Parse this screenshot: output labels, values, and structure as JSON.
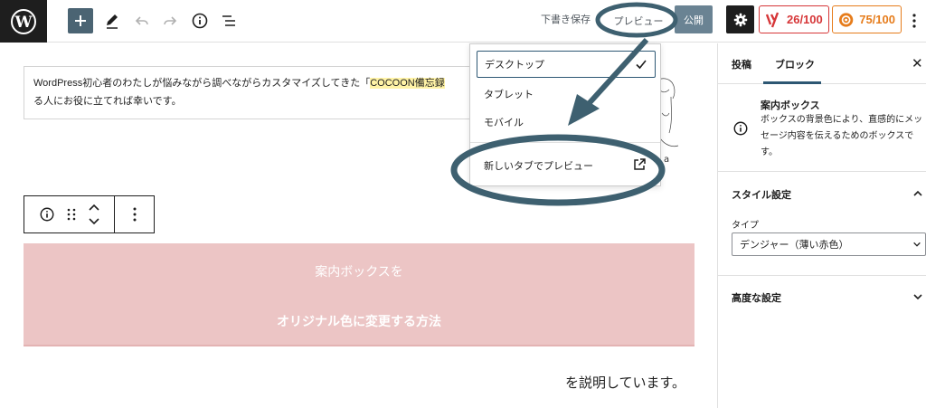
{
  "topbar": {
    "logo_icon": "wordpress-logo",
    "add_icon": "plus-icon",
    "tool_icons": [
      "pencil-icon",
      "undo-icon",
      "redo-icon",
      "info-icon",
      "list-view-icon"
    ],
    "save_draft_label": "下書き保存",
    "preview_label": "プレビュー",
    "publish_label": "公開",
    "settings_icon": "gear-icon",
    "score_red": "26/100",
    "score_orange": "75/100",
    "more_icon": "kebab-icon"
  },
  "editor": {
    "paragraph_before": "WordPress初心者のわたしが悩みながら調べながらカスタマイズしてきた「",
    "paragraph_highlight": "COCOON備忘録",
    "paragraph_line2": "る人にお役に立てれば幸いです。",
    "sketch_letter": "a",
    "notice_line1": "案内ボックスを",
    "notice_line2": "オリジナル色に変更する方法",
    "trailing_text": "を説明しています。"
  },
  "preview_menu": {
    "items": [
      {
        "label": "デスクトップ",
        "checked": true
      },
      {
        "label": "タブレット",
        "checked": false
      },
      {
        "label": "モバイル",
        "checked": false
      }
    ],
    "new_tab_label": "新しいタブでプレビュー",
    "new_tab_icon": "external-link-icon"
  },
  "sidebar": {
    "tab_post": "投稿",
    "tab_block": "ブロック",
    "block_title": "案内ボックス",
    "block_description": "ボックスの背景色により、直感的にメッセージ内容を伝えるためのボックスです。",
    "style_panel_title": "スタイル設定",
    "type_label": "タイプ",
    "type_value": "デンジャー（薄い赤色）",
    "advanced_panel_title": "高度な設定"
  },
  "colors": {
    "accent": "#2d5773",
    "notice_bg": "#ecc5c5",
    "annotation": "#3e6070",
    "score_red": "#d63638",
    "score_orange": "#e67c1b"
  }
}
